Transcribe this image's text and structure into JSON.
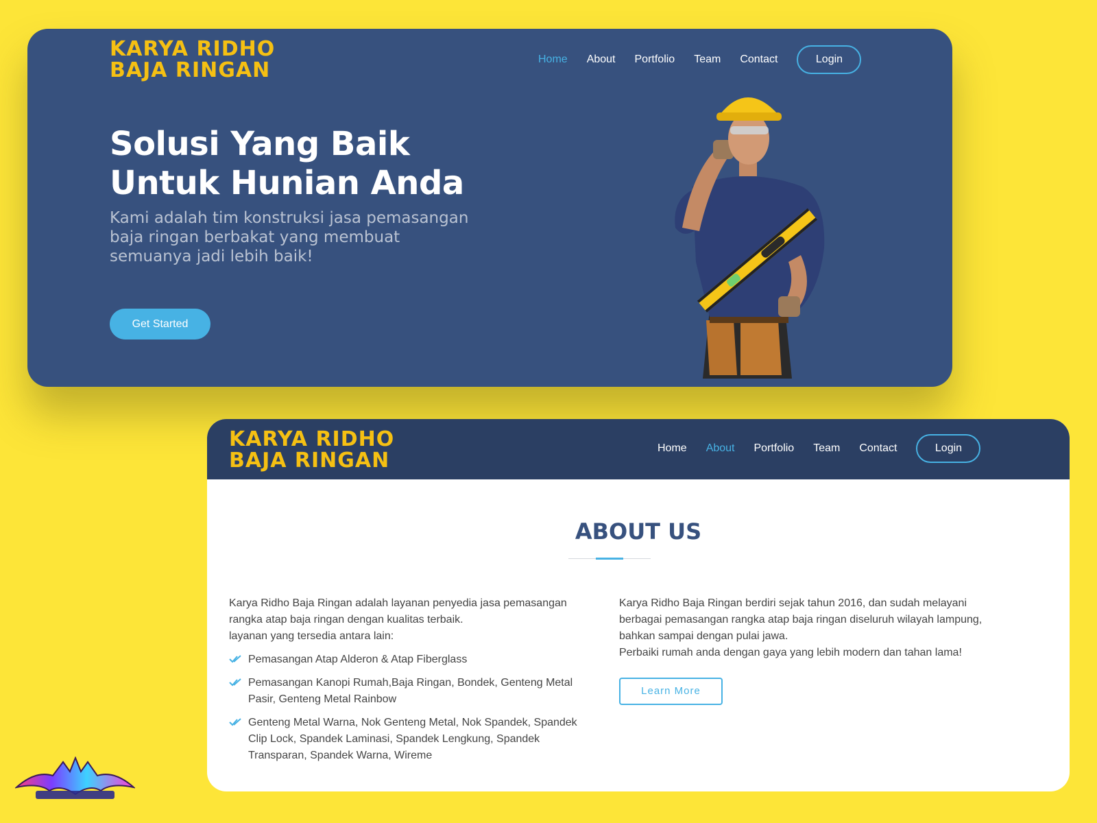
{
  "hero": {
    "logo": [
      "KARYA RIDHO",
      "BAJA RINGAN"
    ],
    "nav": [
      {
        "label": "Home",
        "active": true
      },
      {
        "label": "About",
        "active": false
      },
      {
        "label": "Portfolio",
        "active": false
      },
      {
        "label": "Team",
        "active": false
      },
      {
        "label": "Contact",
        "active": false
      }
    ],
    "login_label": "Login",
    "title": "Solusi Yang Baik Untuk Hunian Anda",
    "subtitle": "Kami adalah tim konstruksi jasa pemasangan baja ringan berbakat yang membuat semuanya jadi lebih baik!",
    "cta_label": "Get Started"
  },
  "about_page": {
    "logo": [
      "KARYA RIDHO",
      "BAJA RINGAN"
    ],
    "nav": [
      {
        "label": "Home",
        "active": false
      },
      {
        "label": "About",
        "active": true
      },
      {
        "label": "Portfolio",
        "active": false
      },
      {
        "label": "Team",
        "active": false
      },
      {
        "label": "Contact",
        "active": false
      }
    ],
    "login_label": "Login",
    "title": "ABOUT US",
    "left_intro_1": "Karya Ridho Baja Ringan adalah layanan penyedia jasa pemasangan rangka atap baja ringan dengan kualitas terbaik.",
    "left_intro_2": "layanan yang tersedia antara lain:",
    "services": [
      "Pemasangan Atap Alderon & Atap Fiberglass",
      "Pemasangan Kanopi Rumah,Baja Ringan, Bondek, Genteng Metal Pasir, Genteng Metal Rainbow",
      "Genteng Metal Warna, Nok Genteng Metal, Nok Spandek, Spandek Clip Lock, Spandek Laminasi, Spandek Lengkung, Spandek Transparan, Spandek Warna, Wireme"
    ],
    "right_text_1": "Karya Ridho Baja Ringan berdiri sejak tahun 2016, dan sudah melayani berbagai pemasangan rangka atap baja ringan diseluruh wilayah lampung, bahkan sampai dengan pulai jawa.",
    "right_text_2": "Perbaiki rumah anda dengan gaya yang lebih modern dan tahan lama!",
    "learn_more_label": "Learn More"
  },
  "colors": {
    "background": "#fde538",
    "hero_bg": "#37517e",
    "header_bg": "#2b3f63",
    "accent": "#47b2e4",
    "logo": "#f5c013"
  },
  "icons": [
    "double-check-icon",
    "construction-worker-image",
    "bat-logo-mark"
  ]
}
